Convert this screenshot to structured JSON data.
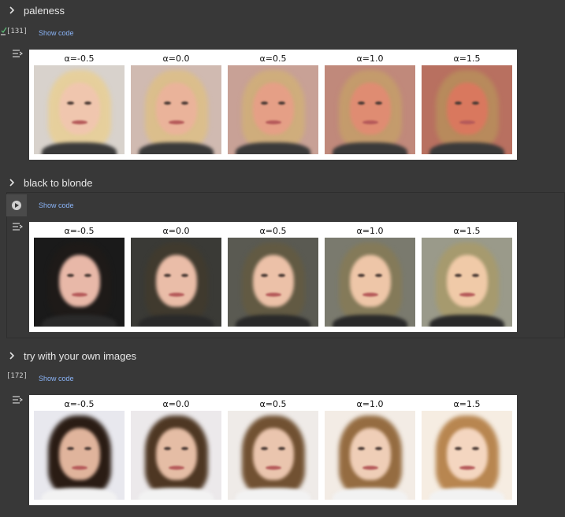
{
  "sections": [
    {
      "title": "paleness",
      "cell_count": "[131]",
      "show_code": "Show code",
      "alphas": [
        "α=-0.5",
        "α=0.0",
        "α=0.5",
        "α=1.0",
        "α=1.5"
      ]
    },
    {
      "title": "black to blonde",
      "cell_count": "",
      "show_code": "Show code",
      "alphas": [
        "α=-0.5",
        "α=0.0",
        "α=0.5",
        "α=1.0",
        "α=1.5"
      ]
    },
    {
      "title": "try with your own images",
      "cell_count": "[172]",
      "show_code": "Show code",
      "alphas": [
        "α=-0.5",
        "α=0.0",
        "α=0.5",
        "α=1.0",
        "α=1.5"
      ]
    }
  ],
  "icons": {
    "expand": "chevron-right-icon",
    "run": "play-circle-icon",
    "output": "output-toggle-icon",
    "status": "check-icon"
  },
  "colors": {
    "background": "#383838",
    "link": "#8ab4f8",
    "check": "#5bb974"
  }
}
